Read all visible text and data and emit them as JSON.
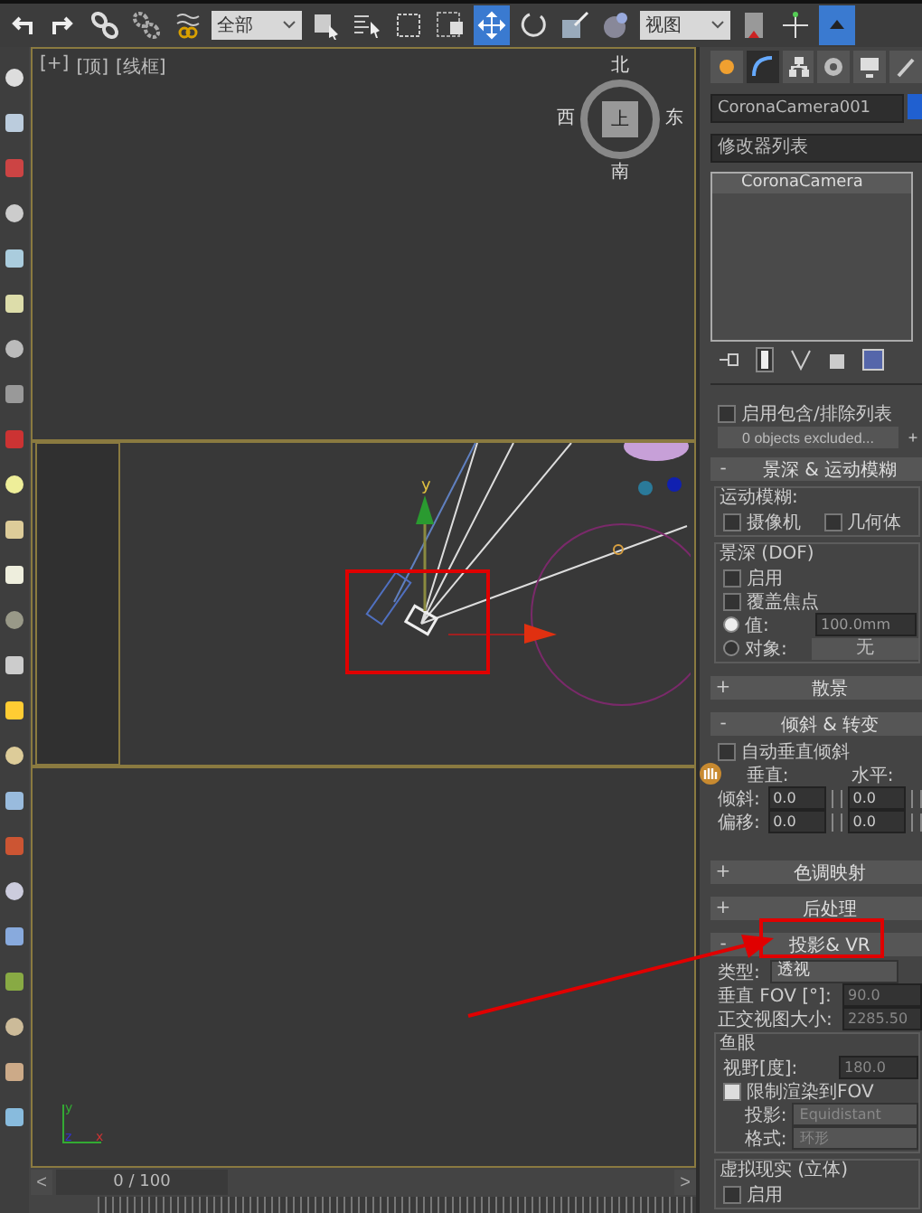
{
  "toolbar": [
    {
      "kind": "undo",
      "selected": false
    },
    {
      "kind": "redo",
      "selected": false
    },
    {
      "kind": "link",
      "selected": false
    },
    {
      "kind": "unlink",
      "selected": false
    },
    {
      "kind": "bind",
      "selected": false
    },
    {
      "kind": "dropdown",
      "value": "全部"
    },
    {
      "kind": "select",
      "selected": false
    },
    {
      "kind": "select-by-name",
      "selected": false
    },
    {
      "kind": "region",
      "selected": false
    },
    {
      "kind": "crossing",
      "selected": false
    },
    {
      "kind": "move",
      "selected": true
    },
    {
      "kind": "rotate",
      "selected": false
    },
    {
      "kind": "scale",
      "selected": false
    },
    {
      "kind": "place",
      "selected": false
    },
    {
      "kind": "dropdown",
      "value": "视图"
    },
    {
      "kind": "pivot",
      "selected": false
    },
    {
      "kind": "manipulate",
      "selected": false
    },
    {
      "kind": "toggle",
      "selected": true
    }
  ],
  "viewport": {
    "labels": [
      "[+]",
      "[顶]",
      "[线框]"
    ],
    "viewcube": {
      "north": "北",
      "west": "西",
      "east": "东",
      "south": "南",
      "face": "上"
    },
    "gizmo_label": "y",
    "axis": {
      "y": "y",
      "z": "z",
      "x": "x"
    }
  },
  "command_panel": {
    "tabs": [
      {
        "kind": "create",
        "selected": false
      },
      {
        "kind": "modify",
        "selected": true
      },
      {
        "kind": "hierarchy",
        "selected": false
      },
      {
        "kind": "motion",
        "selected": false
      },
      {
        "kind": "display",
        "selected": false
      },
      {
        "kind": "utilities",
        "selected": false
      }
    ],
    "object_name": "CoronaCamera001",
    "modifier_list": "修改器列表",
    "stack": [
      {
        "label": "CoronaCamera",
        "selected": true
      }
    ],
    "include_exclude": {
      "label": "启用包含/排除列表",
      "checked": false,
      "button": "0 objects excluded...",
      "add": "+"
    },
    "rollouts": [
      {
        "kind": "dof",
        "sign": "-",
        "title": "景深 & 运动模糊",
        "motion_blur": {
          "label": "运动模糊:",
          "options": [
            {
              "label": "摄像机",
              "checked": false
            },
            {
              "label": "几何体",
              "checked": false
            }
          ]
        },
        "dof": {
          "label": "景深 (DOF)",
          "options": [
            {
              "label": "启用",
              "checked": false
            },
            {
              "label": "覆盖焦点",
              "checked": false
            }
          ],
          "focus": [
            {
              "label": "值:",
              "selected": true,
              "value": "100.0mm"
            },
            {
              "label": "对象:",
              "selected": false,
              "value": "无"
            }
          ]
        }
      },
      {
        "kind": "collapsed",
        "sign": "+",
        "title": "散景"
      },
      {
        "kind": "tilt",
        "sign": "-",
        "title": "倾斜 & 转变",
        "auto": {
          "label": "自动垂直倾斜",
          "checked": false
        },
        "columns": [
          "垂直:",
          "水平:"
        ],
        "rows": [
          {
            "label": "倾斜:",
            "values": [
              "0.0",
              "0.0"
            ]
          },
          {
            "label": "偏移:",
            "values": [
              "0.0",
              "0.0"
            ]
          }
        ]
      },
      {
        "kind": "collapsed",
        "sign": "+",
        "title": "色调映射"
      },
      {
        "kind": "collapsed",
        "sign": "+",
        "title": "后处理"
      },
      {
        "kind": "projection",
        "sign": "-",
        "title": "投影& VR",
        "type": {
          "label": "类型:",
          "value": "透视"
        },
        "fields": [
          {
            "label": "垂直 FOV [°]:",
            "value": "90.0"
          },
          {
            "label": "正交视图大小:",
            "value": "2285.50"
          }
        ],
        "fisheye": {
          "label": "鱼眼",
          "fov": {
            "label": "视野[度]:",
            "value": "180.0"
          },
          "limit": {
            "label": "限制渲染到FOV",
            "checked": true
          },
          "selects": [
            {
              "label": "投影:",
              "value": "Equidistant"
            },
            {
              "label": "格式:",
              "value": "环形"
            }
          ]
        },
        "vr": {
          "label": "虚拟现实 (立体)",
          "enable": {
            "label": "启用",
            "checked": false
          }
        }
      }
    ]
  },
  "timeline": {
    "prev": "<",
    "frame": "0 / 100",
    "next": ">",
    "level": 0
  }
}
